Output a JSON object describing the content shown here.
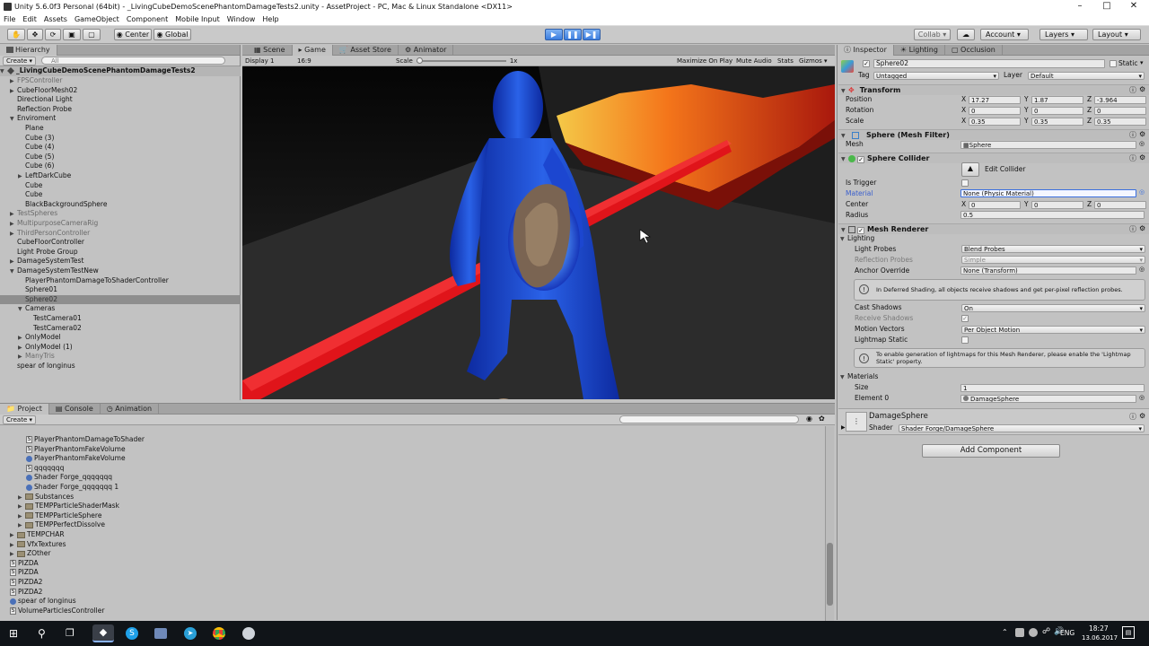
{
  "window": {
    "title": "Unity 5.6.0f3 Personal (64bit) - _LivingCubeDemoScenePhantomDamageTests2.unity - AssetProject - PC, Mac & Linux Standalone <DX11>",
    "minimize": "–",
    "maximize": "□",
    "close": "✕"
  },
  "menu": [
    "File",
    "Edit",
    "Assets",
    "GameObject",
    "Component",
    "Mobile Input",
    "Window",
    "Help"
  ],
  "toolbar": {
    "center_label": "Center",
    "global_label": "Global",
    "collab_label": "Collab ▾",
    "account_label": "Account",
    "layers_label": "Layers",
    "layout_label": "Layout"
  },
  "hierarchy": {
    "tab": "Hierarchy",
    "create": "Create ▾",
    "search_placeholder": "All",
    "scene": "_LivingCubeDemoScenePhantomDamageTests2",
    "items": [
      {
        "label": "FPSController",
        "indent": 1,
        "arrow": "▶",
        "gray": true
      },
      {
        "label": "CubeFloorMesh02",
        "indent": 1,
        "arrow": "▶",
        "gray": false
      },
      {
        "label": "Directional Light",
        "indent": 1,
        "arrow": "",
        "gray": false
      },
      {
        "label": "Reflection Probe",
        "indent": 1,
        "arrow": "",
        "gray": false
      },
      {
        "label": "Enviroment",
        "indent": 1,
        "arrow": "▼",
        "gray": false
      },
      {
        "label": "Plane",
        "indent": 2,
        "arrow": "",
        "gray": false
      },
      {
        "label": "Cube (3)",
        "indent": 2,
        "arrow": "",
        "gray": false
      },
      {
        "label": "Cube (4)",
        "indent": 2,
        "arrow": "",
        "gray": false
      },
      {
        "label": "Cube (5)",
        "indent": 2,
        "arrow": "",
        "gray": false
      },
      {
        "label": "Cube (6)",
        "indent": 2,
        "arrow": "",
        "gray": false
      },
      {
        "label": "LeftDarkCube",
        "indent": 2,
        "arrow": "▶",
        "gray": false
      },
      {
        "label": "Cube",
        "indent": 2,
        "arrow": "",
        "gray": false
      },
      {
        "label": "Cube",
        "indent": 2,
        "arrow": "",
        "gray": false
      },
      {
        "label": "BlackBackgroundSphere",
        "indent": 2,
        "arrow": "",
        "gray": false
      },
      {
        "label": "TestSpheres",
        "indent": 1,
        "arrow": "▶",
        "gray": true
      },
      {
        "label": "MultipurposeCameraRig",
        "indent": 1,
        "arrow": "▶",
        "gray": true
      },
      {
        "label": "ThirdPersonController",
        "indent": 1,
        "arrow": "▶",
        "gray": true
      },
      {
        "label": "CubeFloorController",
        "indent": 1,
        "arrow": "",
        "gray": false
      },
      {
        "label": "Light Probe Group",
        "indent": 1,
        "arrow": "",
        "gray": false
      },
      {
        "label": "DamageSystemTest",
        "indent": 1,
        "arrow": "▶",
        "gray": false
      },
      {
        "label": "DamageSystemTestNew",
        "indent": 1,
        "arrow": "▼",
        "gray": false
      },
      {
        "label": "PlayerPhantomDamageToShaderController",
        "indent": 2,
        "arrow": "",
        "gray": false
      },
      {
        "label": "Sphere01",
        "indent": 2,
        "arrow": "",
        "gray": false
      },
      {
        "label": "Sphere02",
        "indent": 2,
        "arrow": "",
        "gray": false,
        "selected": true
      },
      {
        "label": "Cameras",
        "indent": 2,
        "arrow": "▼",
        "gray": false
      },
      {
        "label": "TestCamera01",
        "indent": 3,
        "arrow": "",
        "gray": false
      },
      {
        "label": "TestCamera02",
        "indent": 3,
        "arrow": "",
        "gray": false
      },
      {
        "label": "OnlyModel",
        "indent": 2,
        "arrow": "▶",
        "gray": false
      },
      {
        "label": "OnlyModel (1)",
        "indent": 2,
        "arrow": "▶",
        "gray": false
      },
      {
        "label": "ManyTris",
        "indent": 2,
        "arrow": "▶",
        "gray": true
      },
      {
        "label": "spear of longinus",
        "indent": 1,
        "arrow": "",
        "gray": false
      }
    ]
  },
  "views": {
    "tabs": [
      "Scene",
      "Game",
      "Asset Store",
      "Animator"
    ],
    "display": "Display 1",
    "aspect": "16:9",
    "scale_label": "Scale",
    "scale_value": "1x",
    "toggles": [
      "Maximize On Play",
      "Mute Audio",
      "Stats",
      "Gizmos ▾"
    ]
  },
  "project": {
    "tabs": [
      "Project",
      "Console",
      "Animation"
    ],
    "create": "Create ▾",
    "items": [
      {
        "label": "PlayerPhantomDamageToShader",
        "indent": 3,
        "type": "sbox"
      },
      {
        "label": "PlayerPhantomFakeVolume",
        "indent": 3,
        "type": "sbox"
      },
      {
        "label": "PlayerPhantomFakeVolume",
        "indent": 3,
        "type": "dot"
      },
      {
        "label": "qqqqqqq",
        "indent": 3,
        "type": "sbox"
      },
      {
        "label": "Shader Forge_qqqqqqq",
        "indent": 3,
        "type": "dot"
      },
      {
        "label": "Shader Forge_qqqqqqq 1",
        "indent": 3,
        "type": "dot"
      },
      {
        "label": "Substances",
        "indent": 2,
        "type": "folder"
      },
      {
        "label": "TEMPParticleShaderMask",
        "indent": 2,
        "type": "folder"
      },
      {
        "label": "TEMPParticleSphere",
        "indent": 2,
        "type": "folder"
      },
      {
        "label": "TEMPPerfectDissolve",
        "indent": 2,
        "type": "folder"
      },
      {
        "label": "TEMPCHAR",
        "indent": 1,
        "type": "folder"
      },
      {
        "label": "VfxTextures",
        "indent": 1,
        "type": "folder"
      },
      {
        "label": "ZOther",
        "indent": 1,
        "type": "folder"
      },
      {
        "label": "PIZDA",
        "indent": 1,
        "type": "sbox"
      },
      {
        "label": "PIZDA",
        "indent": 1,
        "type": "sbox"
      },
      {
        "label": "PIZDA2",
        "indent": 1,
        "type": "sbox"
      },
      {
        "label": "PIZDA2",
        "indent": 1,
        "type": "sbox"
      },
      {
        "label": "spear of longinus",
        "indent": 1,
        "type": "dot"
      },
      {
        "label": "VolumeParticlesController",
        "indent": 1,
        "type": "sbox"
      }
    ]
  },
  "inspector": {
    "tabs": [
      "Inspector",
      "Lighting",
      "Occlusion"
    ],
    "name": "Sphere02",
    "static_label": "Static",
    "tag_label": "Tag",
    "tag_value": "Untagged",
    "layer_label": "Layer",
    "layer_value": "Default",
    "transform": {
      "title": "Transform",
      "position_label": "Position",
      "position": [
        "17.27",
        "1.87",
        "-3.964"
      ],
      "rotation_label": "Rotation",
      "rotation": [
        "0",
        "0",
        "0"
      ],
      "scale_label": "Scale",
      "scale": [
        "0.35",
        "0.35",
        "0.35"
      ]
    },
    "mesh_filter": {
      "title": "Sphere (Mesh Filter)",
      "mesh_label": "Mesh",
      "mesh_value": "Sphere"
    },
    "collider": {
      "title": "Sphere Collider",
      "edit_label": "Edit Collider",
      "is_trigger_label": "Is Trigger",
      "material_label": "Material",
      "material_value": "None (Physic Material)",
      "center_label": "Center",
      "center": [
        "0",
        "0",
        "0"
      ],
      "radius_label": "Radius",
      "radius_value": "0.5"
    },
    "renderer": {
      "title": "Mesh Renderer",
      "lighting_label": "Lighting",
      "light_probes_label": "Light Probes",
      "light_probes_value": "Blend Probes",
      "reflection_probes_label": "Reflection Probes",
      "reflection_probes_value": "Simple",
      "anchor_label": "Anchor Override",
      "anchor_value": "None (Transform)",
      "info1": "In Deferred Shading, all objects receive shadows and get per-pixel reflection probes.",
      "cast_shadows_label": "Cast Shadows",
      "cast_shadows_value": "On",
      "receive_shadows_label": "Receive Shadows",
      "motion_vectors_label": "Motion Vectors",
      "motion_vectors_value": "Per Object Motion",
      "lightmap_static_label": "Lightmap Static",
      "info2": "To enable generation of lightmaps for this Mesh Renderer, please enable the 'Lightmap Static' property.",
      "materials_label": "Materials",
      "size_label": "Size",
      "size_value": "1",
      "element_label": "Element 0",
      "element_value": "DamageSphere"
    },
    "material": {
      "name": "DamageSphere",
      "shader_label": "Shader",
      "shader_value": "Shader Forge/DamageSphere"
    },
    "add_component": "Add Component"
  },
  "taskbar": {
    "lang": "ENG",
    "time": "18:27",
    "date": "13.06.2017"
  },
  "colors": {
    "accent": "#3c7ee0",
    "spear": "#e0141a",
    "figure": "#1b4bd8"
  }
}
